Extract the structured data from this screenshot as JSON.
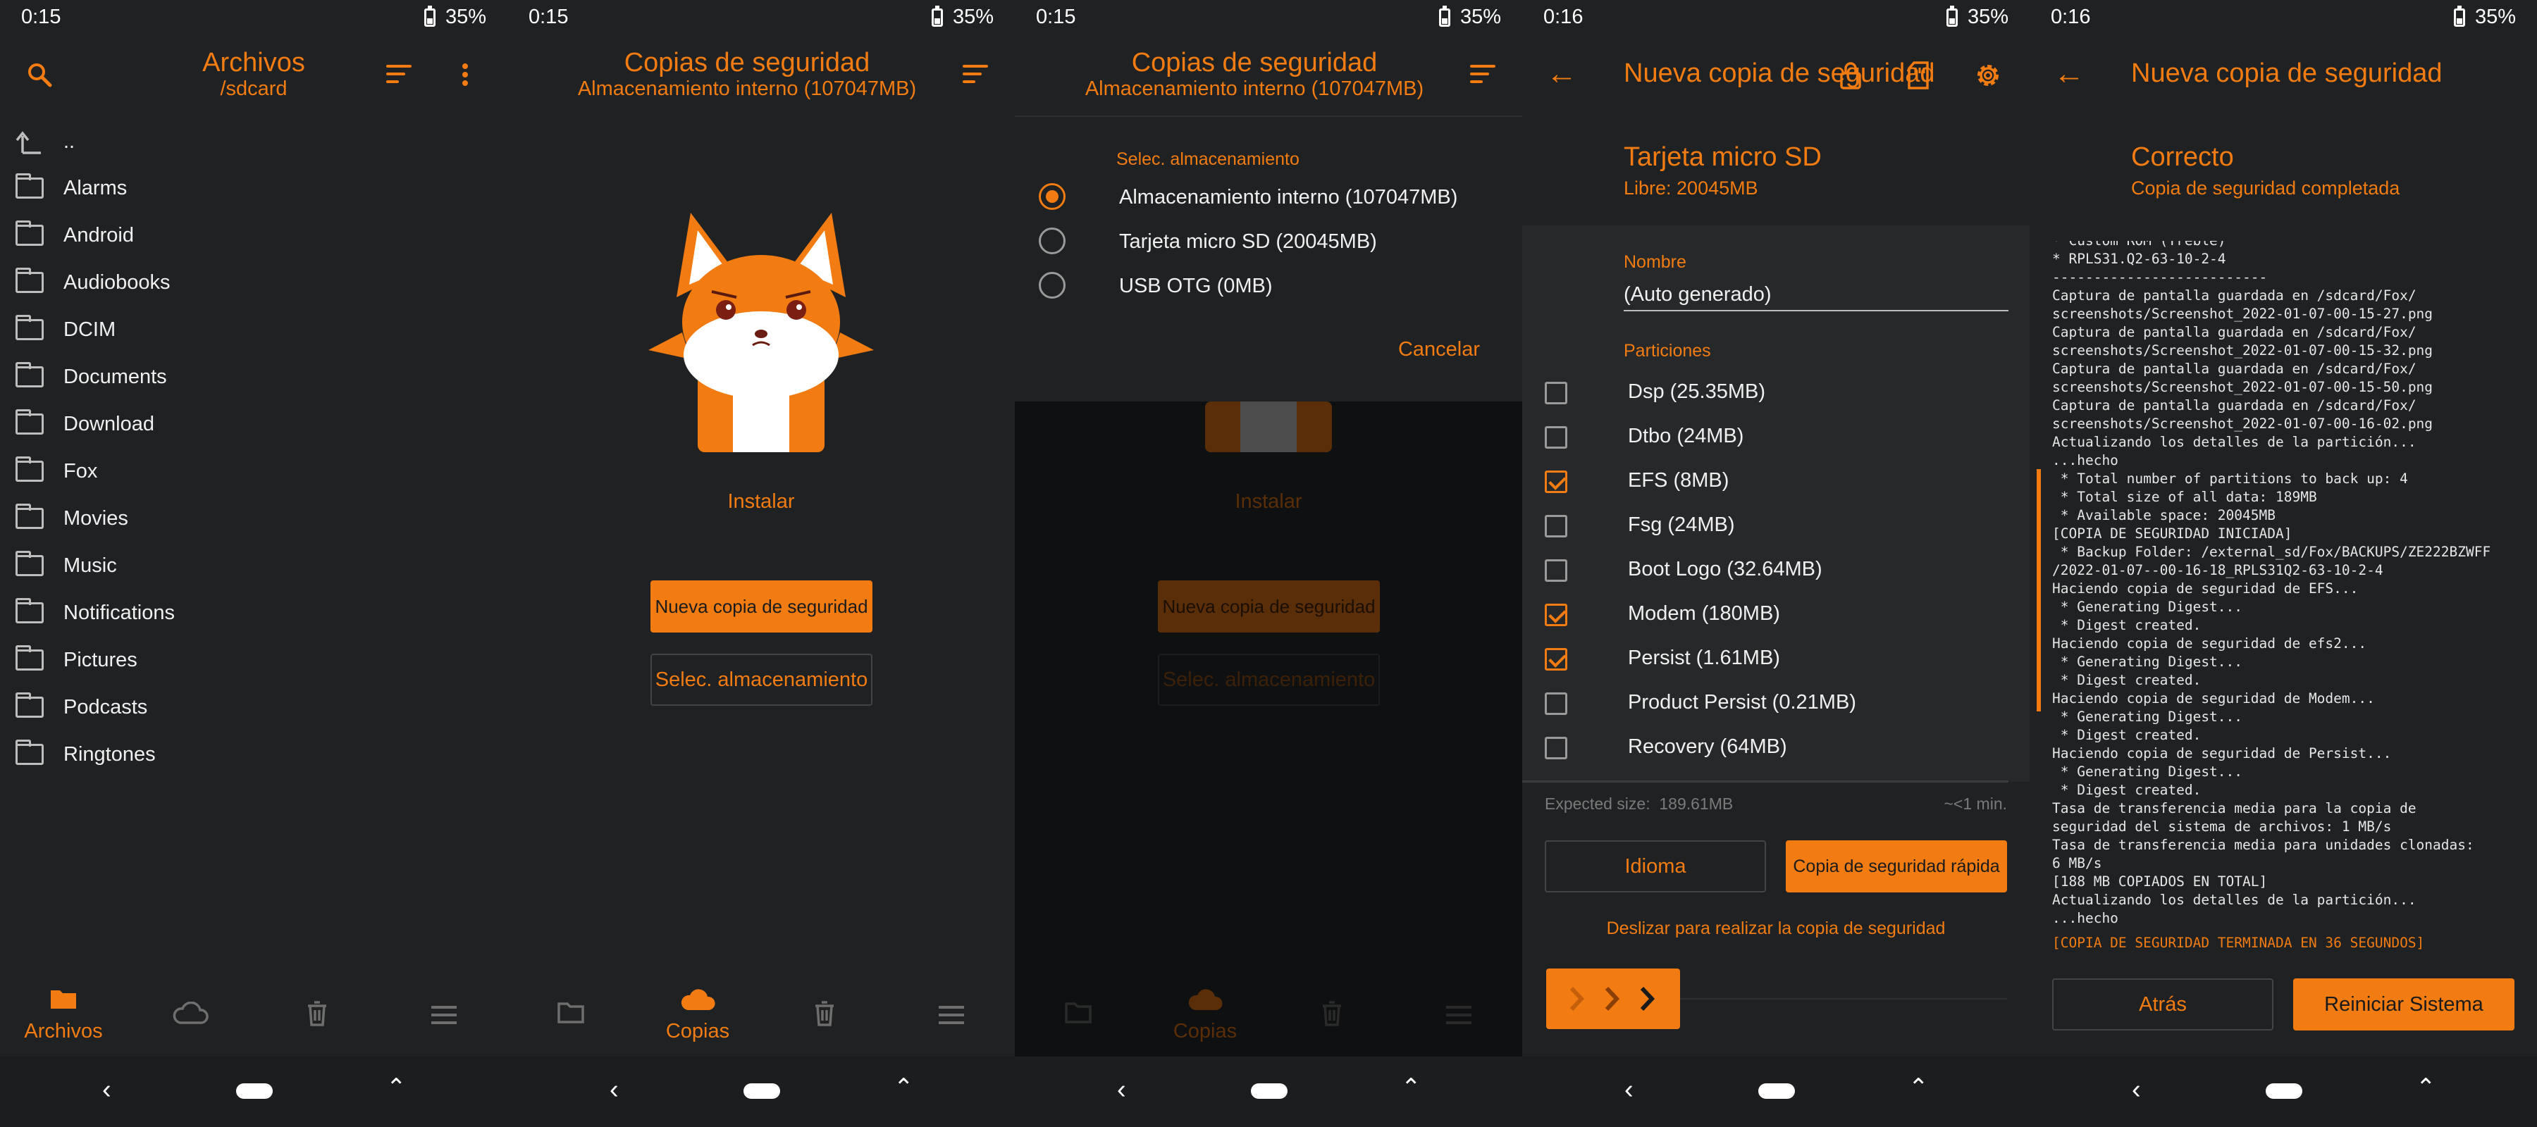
{
  "colors": {
    "accent": "#f27c12",
    "background": "#1f2123",
    "text": "#e8e8e8",
    "muted": "#6e6e6e"
  },
  "nav": {
    "archivos": "Archivos",
    "copias": "Copias"
  },
  "screen1": {
    "time": "0:15",
    "battery": "35%",
    "title": "Archivos",
    "subtitle": "/sdcard",
    "parent": "..",
    "folders": [
      "Alarms",
      "Android",
      "Audiobooks",
      "DCIM",
      "Documents",
      "Download",
      "Fox",
      "Movies",
      "Music",
      "Notifications",
      "Pictures",
      "Podcasts",
      "Ringtones"
    ]
  },
  "screen2": {
    "time": "0:15",
    "battery": "35%",
    "title": "Copias de seguridad",
    "subtitle": "Almacenamiento interno (107047MB)",
    "install": "Instalar",
    "new_backup": "Nueva copia de seguridad",
    "select_storage": "Selec. almacenamiento"
  },
  "screen3": {
    "time": "0:15",
    "battery": "35%",
    "title": "Copias de seguridad",
    "subtitle": "Almacenamiento interno (107047MB)",
    "dialog_title": "Selec. almacenamiento",
    "options": [
      "Almacenamiento interno (107047MB)",
      "Tarjeta micro SD (20045MB)",
      "USB OTG (0MB)"
    ],
    "cancel": "Cancelar",
    "install": "Instalar",
    "new_backup": "Nueva copia de seguridad",
    "select_storage": "Selec. almacenamiento"
  },
  "screen4": {
    "time": "0:16",
    "battery": "35%",
    "title": "Nueva copia de seguridad",
    "storage": "Tarjeta micro SD",
    "free": "Libre: 20045MB",
    "name_label": "Nombre",
    "name_value": "(Auto generado)",
    "partitions_label": "Particiones",
    "partitions": [
      {
        "label": "Dsp (25.35MB)",
        "checked": false
      },
      {
        "label": "Dtbo (24MB)",
        "checked": false
      },
      {
        "label": "EFS (8MB)",
        "checked": true
      },
      {
        "label": "Fsg (24MB)",
        "checked": false
      },
      {
        "label": "Boot Logo (32.64MB)",
        "checked": false
      },
      {
        "label": "Modem (180MB)",
        "checked": true
      },
      {
        "label": "Persist (1.61MB)",
        "checked": true
      },
      {
        "label": "Product Persist (0.21MB)",
        "checked": false
      },
      {
        "label": "Recovery (64MB)",
        "checked": false
      }
    ],
    "expected": "Expected size:  189.61MB",
    "eta": "~<1 min.",
    "idioma": "Idioma",
    "quick": "Copia de seguridad rápida",
    "slide": "Deslizar para realizar la copia de seguridad"
  },
  "screen5": {
    "time": "0:16",
    "battery": "35%",
    "title": "Nueva copia de seguridad",
    "status": "Correcto",
    "status_sub": "Copia de seguridad completada",
    "log": [
      "* Custom ROM (Treble)",
      "* RPLS31.Q2-63-10-2-4",
      "--------------------------",
      "Captura de pantalla guardada en /sdcard/Fox/",
      "screenshots/Screenshot_2022-01-07-00-15-27.png",
      "Captura de pantalla guardada en /sdcard/Fox/",
      "screenshots/Screenshot_2022-01-07-00-15-32.png",
      "Captura de pantalla guardada en /sdcard/Fox/",
      "screenshots/Screenshot_2022-01-07-00-15-50.png",
      "Captura de pantalla guardada en /sdcard/Fox/",
      "screenshots/Screenshot_2022-01-07-00-16-02.png",
      "Actualizando los detalles de la partición...",
      "...hecho",
      " * Total number of partitions to back up: 4",
      " * Total size of all data: 189MB",
      " * Available space: 20045MB",
      "[COPIA DE SEGURIDAD INICIADA]",
      " * Backup Folder: /external_sd/Fox/BACKUPS/ZE222BZWFF",
      "/2022-01-07--00-16-18_RPLS31Q2-63-10-2-4",
      "Haciendo copia de seguridad de EFS...",
      " * Generating Digest...",
      " * Digest created.",
      "Haciendo copia de seguridad de efs2...",
      " * Generating Digest...",
      " * Digest created.",
      "Haciendo copia de seguridad de Modem...",
      " * Generating Digest...",
      " * Digest created.",
      "Haciendo copia de seguridad de Persist...",
      " * Generating Digest...",
      " * Digest created.",
      "Tasa de transferencia media para la copia de",
      "seguridad del sistema de archivos: 1 MB/s",
      "Tasa de transferencia media para unidades clonadas:",
      "6 MB/s",
      "[188 MB COPIADOS EN TOTAL]",
      "Actualizando los detalles de la partición...",
      "...hecho"
    ],
    "log_final": "[COPIA DE SEGURIDAD TERMINADA EN 36 SEGUNDOS]",
    "back": "Atrás",
    "reboot": "Reiniciar Sistema"
  }
}
